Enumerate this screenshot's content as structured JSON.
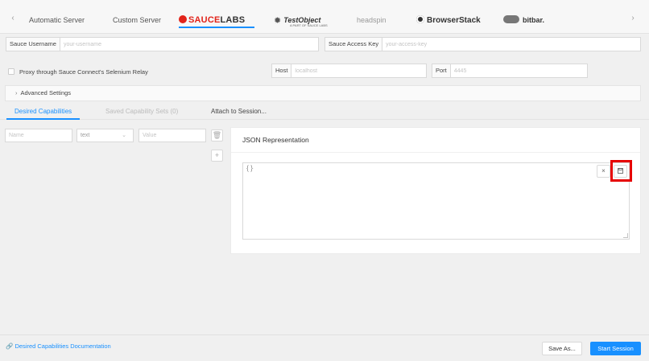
{
  "server_tabs": {
    "prev_arrow": "‹",
    "next_arrow": "›",
    "automatic": "Automatic Server",
    "custom": "Custom Server",
    "saucelabs": {
      "prefix": "SAUCE",
      "suffix": "LABS"
    },
    "testobject": {
      "name": "TestObject",
      "sub": "A PART OF SAUCE LABS"
    },
    "headspin": "headspin",
    "browserstack": "BrowserStack",
    "bitbar": "bitbar.",
    "active": "saucelabs"
  },
  "credentials": {
    "username_label": "Sauce Username",
    "username_placeholder": "your-username",
    "access_key_label": "Sauce Access Key",
    "access_key_placeholder": "your-access-key"
  },
  "proxy": {
    "label": "Proxy through Sauce Connect's Selenium Relay",
    "host_label": "Host",
    "host_placeholder": "localhost",
    "port_label": "Port",
    "port_placeholder": "4445"
  },
  "advanced": {
    "label": "Advanced Settings"
  },
  "capability_tabs": {
    "desired": "Desired Capabilities",
    "saved": "Saved Capability Sets (0)",
    "attach": "Attach to Session..."
  },
  "capability_row": {
    "name_placeholder": "Name",
    "type_value": "text",
    "value_placeholder": "Value"
  },
  "json_panel": {
    "title": "JSON Representation",
    "content": "{}",
    "close_symbol": "×"
  },
  "footer": {
    "doc_link": "Desired Capabilities Documentation",
    "save_as": "Save As...",
    "start_session": "Start Session"
  },
  "colors": {
    "accent": "#1890ff",
    "sauce_red": "#e2231a",
    "highlight": "#e60000"
  }
}
